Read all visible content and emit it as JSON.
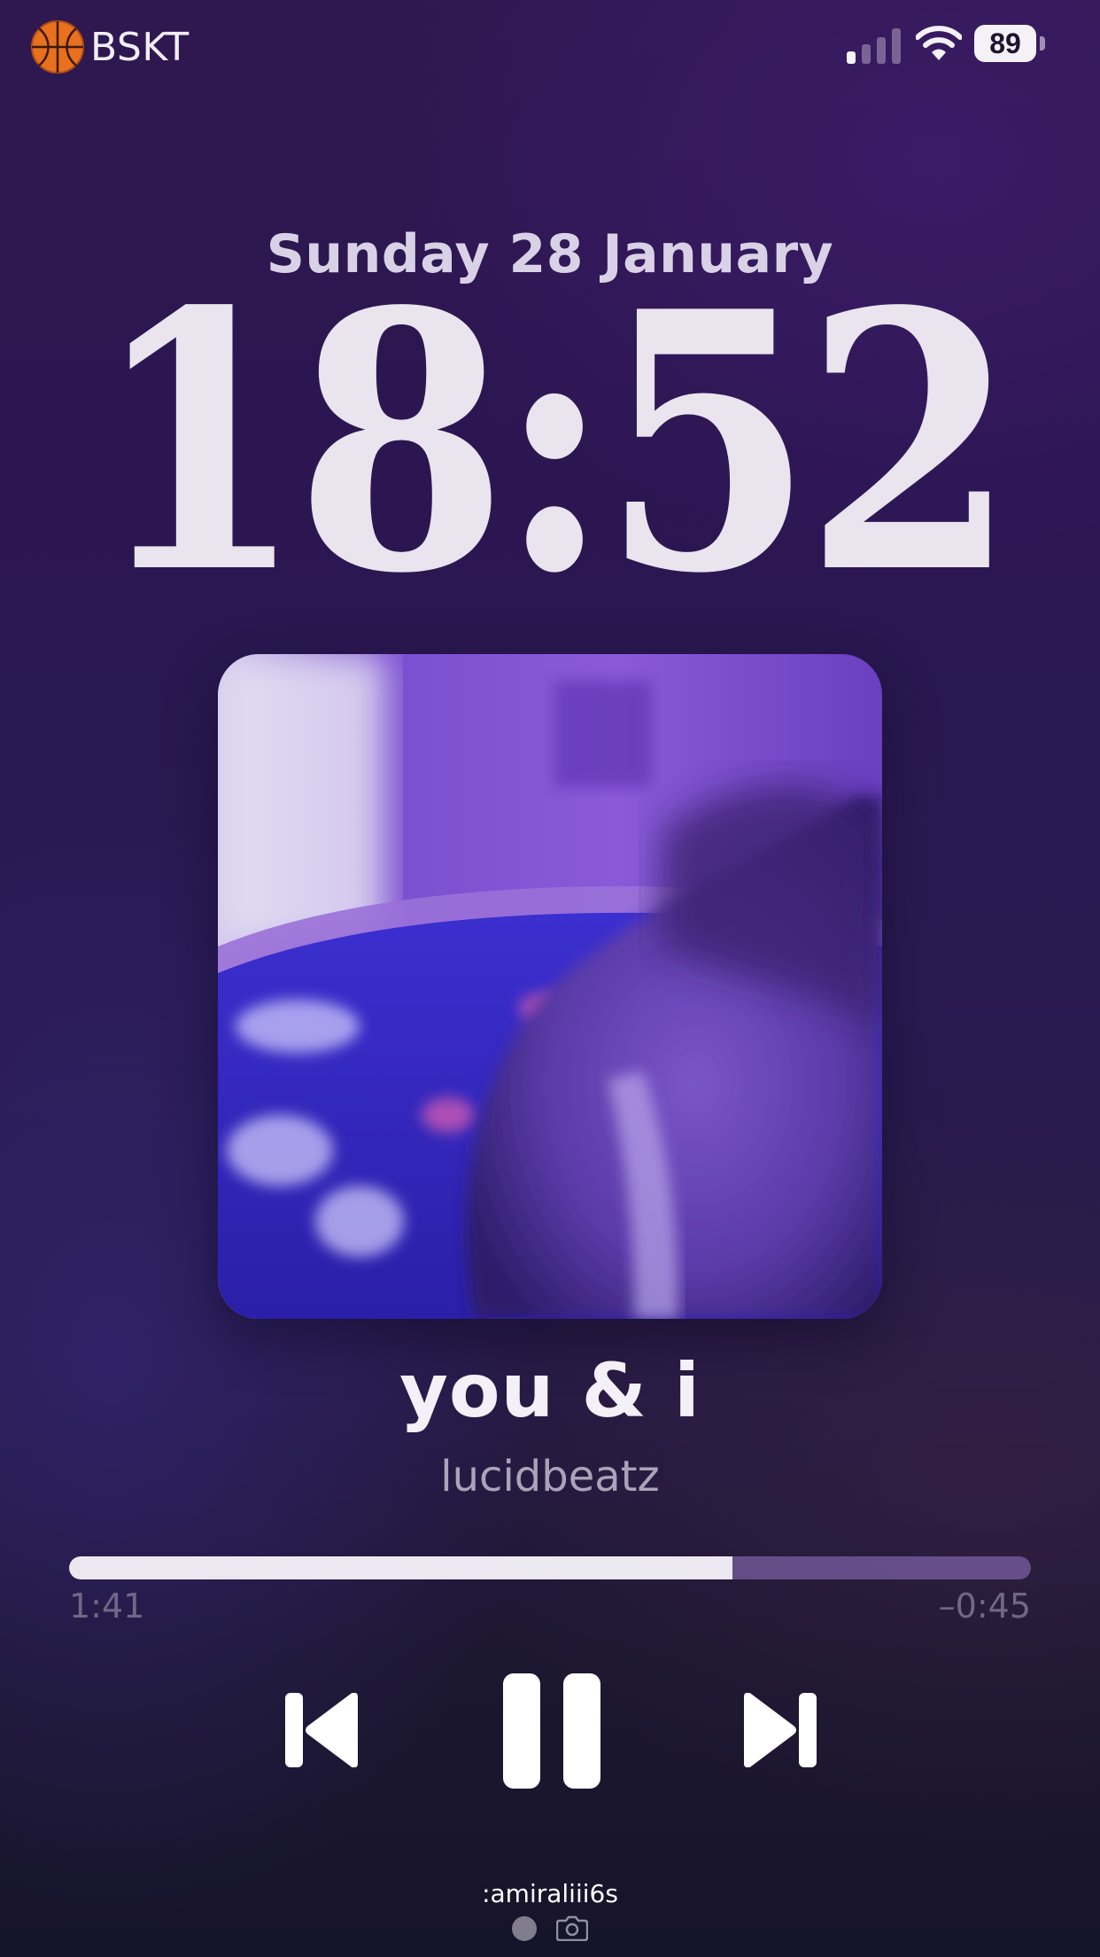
{
  "status_bar": {
    "carrier_label": "BSKT",
    "carrier_icon": "basketball-icon",
    "battery_level": "89",
    "signal_bars_active": 1,
    "signal_bars_total": 4,
    "wifi_icon": "wifi-icon"
  },
  "lock_screen": {
    "date": "Sunday 28 January",
    "time": "18:52"
  },
  "now_playing": {
    "artwork_icon": "album-artwork",
    "title": "you & i",
    "artist": "lucidbeatz",
    "elapsed": "1:41",
    "remaining": "–0:45",
    "progress_fraction": 0.69
  },
  "controls": {
    "previous_icon": "skip-back-icon",
    "pause_icon": "pause-icon",
    "next_icon": "skip-forward-icon"
  },
  "footer": {
    "watermark": ":amiraliii6s",
    "flashlight_icon": "flashlight-icon",
    "camera_icon": "camera-icon"
  },
  "colors": {
    "background_top": "#2f1850",
    "background_bottom": "#16142a",
    "text_primary": "#e9e4ee",
    "text_secondary": "#aba3b9",
    "progress_played": "#ece8f2",
    "progress_remaining": "#8a6fb8"
  }
}
